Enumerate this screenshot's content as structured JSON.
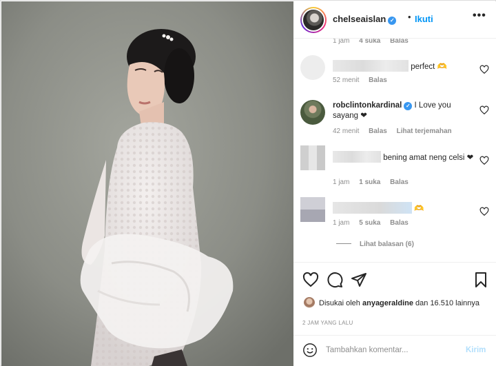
{
  "header": {
    "username": "chelseaislan",
    "dot": "•",
    "follow_label": "Ikuti",
    "more_icon": "more-horizontal-icon"
  },
  "comments": [
    {
      "text_suffix": "",
      "meta": {
        "time": "1 jam",
        "likes": "4 suka",
        "reply": "Balas"
      }
    },
    {
      "text_suffix": "perfect 🫶",
      "meta": {
        "time": "52 menit",
        "reply": "Balas"
      }
    },
    {
      "username": "robclintonkardinal",
      "text": "I Love you sayang ❤",
      "meta": {
        "time": "42 menit",
        "reply": "Balas",
        "translate": "Lihat terjemahan"
      }
    },
    {
      "text": "bening amat neng celsi ❤",
      "meta": {
        "time": "1 jam",
        "likes": "1 suka",
        "reply": "Balas"
      }
    },
    {
      "text_suffix": "🫶",
      "meta": {
        "time": "1 jam",
        "likes": "5 suka",
        "reply": "Balas"
      }
    }
  ],
  "view_replies": "Lihat balasan (6)",
  "likes": {
    "prefix": "Disukai oleh",
    "user": "anyageraldine",
    "suffix": "dan 16.510 lainnya"
  },
  "timestamp": "2 JAM YANG LALU",
  "add_comment": {
    "placeholder": "Tambahkan komentar...",
    "post_label": "Kirim"
  },
  "colors": {
    "accent": "#0095f6",
    "verified": "#3897f0",
    "post_disabled": "#b2dffc"
  }
}
